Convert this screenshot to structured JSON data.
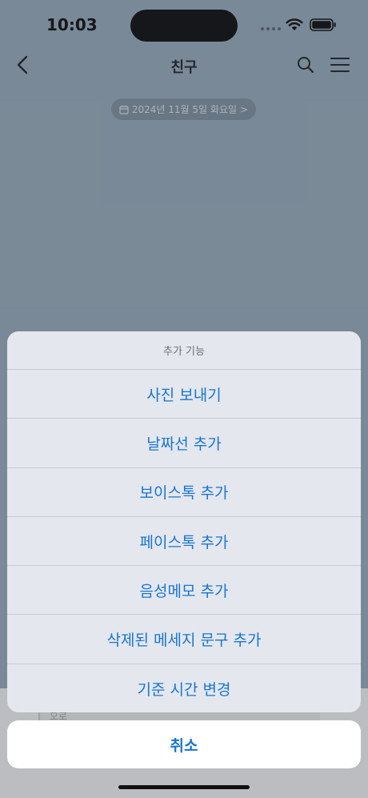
{
  "status_bar": {
    "time": "10:03"
  },
  "nav": {
    "title": "친구"
  },
  "date_pill": {
    "label": "2024년 11월 5일 화요일",
    "chevron": ">"
  },
  "input": {
    "text": "오로"
  },
  "action_sheet": {
    "title": "추가 기능",
    "items": [
      {
        "label": "사진 보내기"
      },
      {
        "label": "날짜선 추가"
      },
      {
        "label": "보이스톡 추가"
      },
      {
        "label": "페이스톡 추가"
      },
      {
        "label": "음성메모 추가"
      },
      {
        "label": "삭제된 메세지 문구 추가"
      },
      {
        "label": "기준 시간 변경"
      }
    ],
    "cancel_label": "취소"
  },
  "icons": {
    "back": "chevron-left-icon",
    "search": "search-icon",
    "menu": "hamburger-menu-icon",
    "calendar": "calendar-icon",
    "wifi": "wifi-icon",
    "battery": "battery-icon"
  },
  "colors": {
    "accent": "#1976d2",
    "chat_background": "#9bb0c1",
    "sheet_background": "#e4e7ed"
  }
}
